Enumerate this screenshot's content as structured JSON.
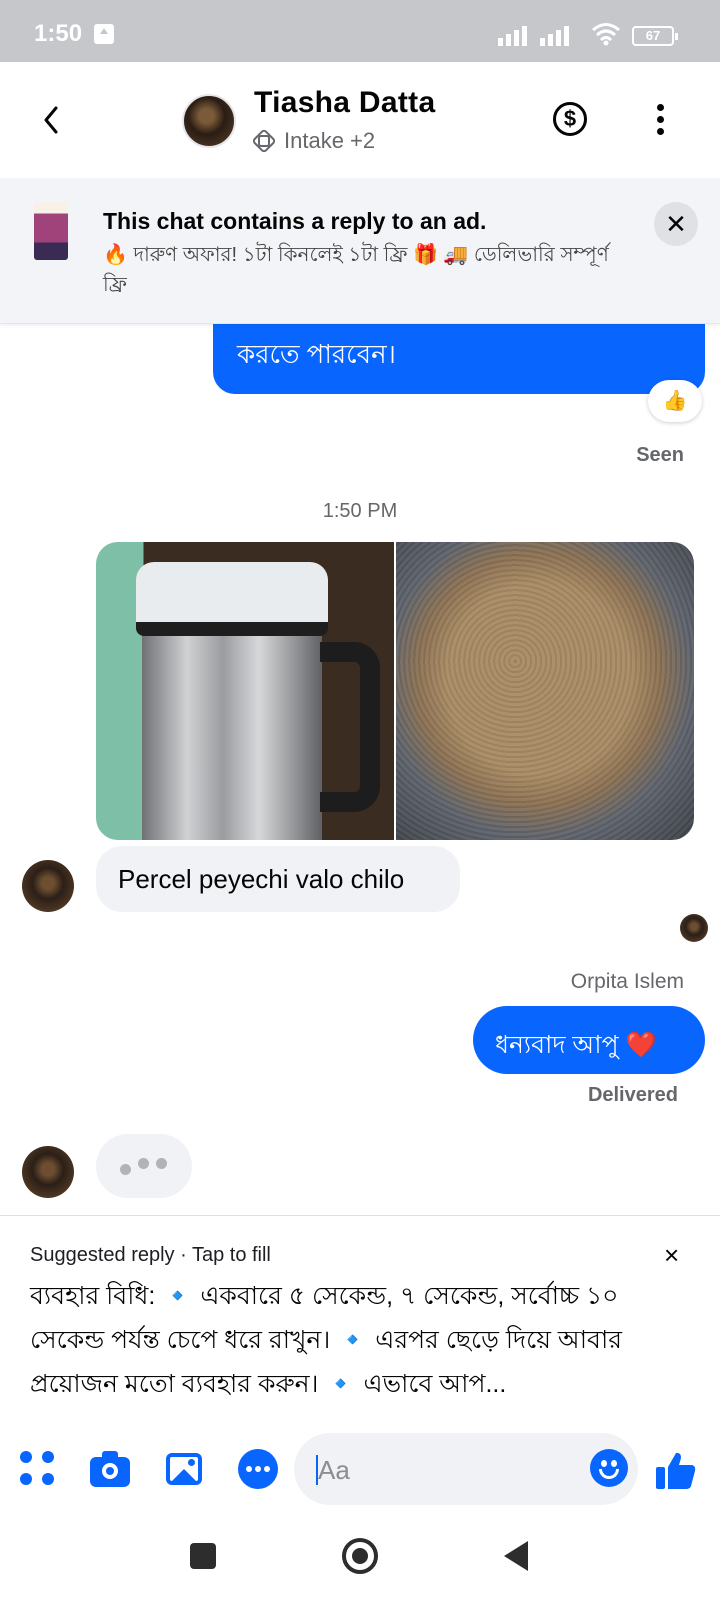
{
  "status_bar": {
    "time": "1:50",
    "battery": "67"
  },
  "header": {
    "contact_name": "Tiasha Datta",
    "subtitle": "Intake +2"
  },
  "ad_banner": {
    "title": "This chat contains a reply to an ad.",
    "text": "🔥 দারুণ অফার! ১টা কিনলেই ১টা ফ্রি 🎁 🚚 ডেলিভারি সম্পূর্ণ ফ্রি"
  },
  "messages": {
    "msg1_text": "করতে পারবেন।",
    "reaction": "👍",
    "seen_label": "Seen",
    "timestamp": "1:50 PM",
    "msg2_text": "Percel peyechi valo chilo",
    "sender_name": "Orpita Islem",
    "msg3_text": "ধন্যবাদ আপু",
    "msg3_emoji": "❤️",
    "delivered_label": "Delivered"
  },
  "suggested_reply": {
    "label": "Suggested reply · Tap to fill",
    "close": "×",
    "text": "ব্যবহার বিধি: 🔹 একবারে ৫ সেকেন্ড, ৭ সেকেন্ড, সর্বোচ্চ ১০ সেকেন্ড পর্যন্ত চেপে ধরে রাখুন। 🔹 এরপর ছেড়ে দিয়ে আবার প্রয়োজন মতো ব্যবহার করুন। 🔹 এভাবে আপ..."
  },
  "composer": {
    "placeholder": "Aa"
  },
  "colors": {
    "accent": "#0866ff",
    "incoming_bubble": "#f0f2f5",
    "status_bar": "#c5c7cb"
  }
}
